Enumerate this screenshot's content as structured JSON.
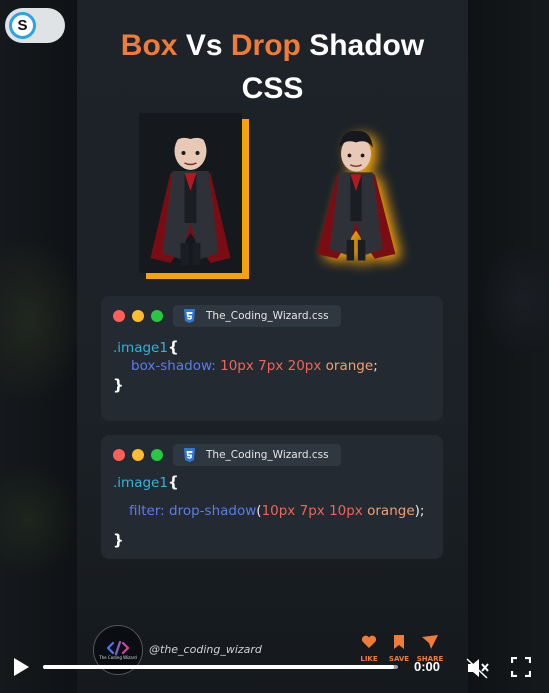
{
  "toggle": {
    "letter": "S"
  },
  "title": {
    "word1": "Box",
    "word2": "Vs",
    "word3": "Drop",
    "word4": "Shadow",
    "line2": "CSS"
  },
  "colors": {
    "accent": "#f07c3a",
    "shadow_orange": "#f5a30a",
    "card_bg": "#232a31"
  },
  "cards": [
    {
      "filename": "The_Coding_Wizard.css",
      "selector": ".image1",
      "open_brace": "{",
      "property": "box-shadow:",
      "v1": "10px",
      "v2": "7px",
      "v3": "20px",
      "v4": "orange",
      "semicolon": ";",
      "close_brace": "}"
    },
    {
      "filename": "The_Coding_Wizard.css",
      "selector": ".image1",
      "open_brace": "{",
      "property": "filter:",
      "func": "drop-shadow",
      "paren_open": "(",
      "v1": "10px",
      "v2": "7px",
      "v3": "10px",
      "v4": "orange",
      "paren_close": ");",
      "close_brace": "}"
    }
  ],
  "channel": {
    "logo_text": "The Coding Wizard",
    "handle": "@the_coding_wizard"
  },
  "actions": {
    "like": "LIKE",
    "save": "SAVE",
    "share": "SHARE"
  },
  "player": {
    "time": "0:00",
    "progress": 0.99,
    "play_icon": "play-icon",
    "mute_icon": "muted-speaker-icon",
    "fullscreen_icon": "fullscreen-icon"
  }
}
